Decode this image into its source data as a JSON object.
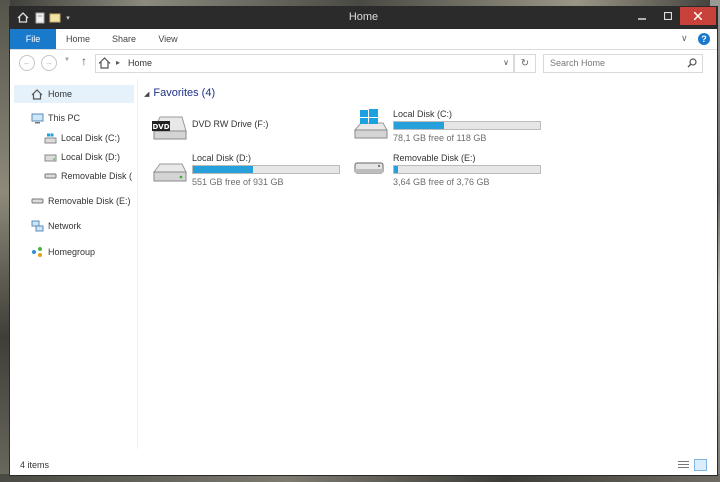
{
  "window": {
    "title": "Home"
  },
  "ribbon": {
    "tabs": [
      {
        "label": "File"
      },
      {
        "label": "Home"
      },
      {
        "label": "Share"
      },
      {
        "label": "View"
      }
    ]
  },
  "address": {
    "path": "Home",
    "search_placeholder": "Search Home"
  },
  "nav_pane": {
    "items": [
      {
        "label": "Home",
        "icon": "home-icon",
        "selected": true
      },
      {
        "label": "This PC",
        "icon": "computer-icon"
      },
      {
        "label": "Local Disk (C:)",
        "icon": "windows-drive-icon"
      },
      {
        "label": "Local Disk (D:)",
        "icon": "drive-icon"
      },
      {
        "label": "Removable Disk (",
        "icon": "removable-drive-icon"
      },
      {
        "label": "Removable Disk (E:)",
        "icon": "removable-drive-icon"
      },
      {
        "label": "Network",
        "icon": "network-icon"
      },
      {
        "label": "Homegroup",
        "icon": "homegroup-icon"
      }
    ]
  },
  "content": {
    "group_title": "Favorites (4)",
    "drives": [
      {
        "name": "DVD RW Drive (F:)",
        "icon": "dvd-drive-icon",
        "free_text": "",
        "used_fraction": null
      },
      {
        "name": "Local Disk (C:)",
        "icon": "windows-drive-icon",
        "free_text": "78,1 GB free of 118 GB",
        "used_fraction": 0.34
      },
      {
        "name": "Local Disk (D:)",
        "icon": "drive-icon",
        "free_text": "551 GB free of 931 GB",
        "used_fraction": 0.41
      },
      {
        "name": "Removable Disk (E:)",
        "icon": "removable-drive-icon",
        "free_text": "3,64 GB free of 3,76 GB",
        "used_fraction": 0.03
      }
    ]
  },
  "status": {
    "item_count": "4 items"
  },
  "colors": {
    "accent": "#1979ca",
    "bar_fill": "#26a0da",
    "close": "#c8413a",
    "titlebar": "#2b2b2b"
  }
}
